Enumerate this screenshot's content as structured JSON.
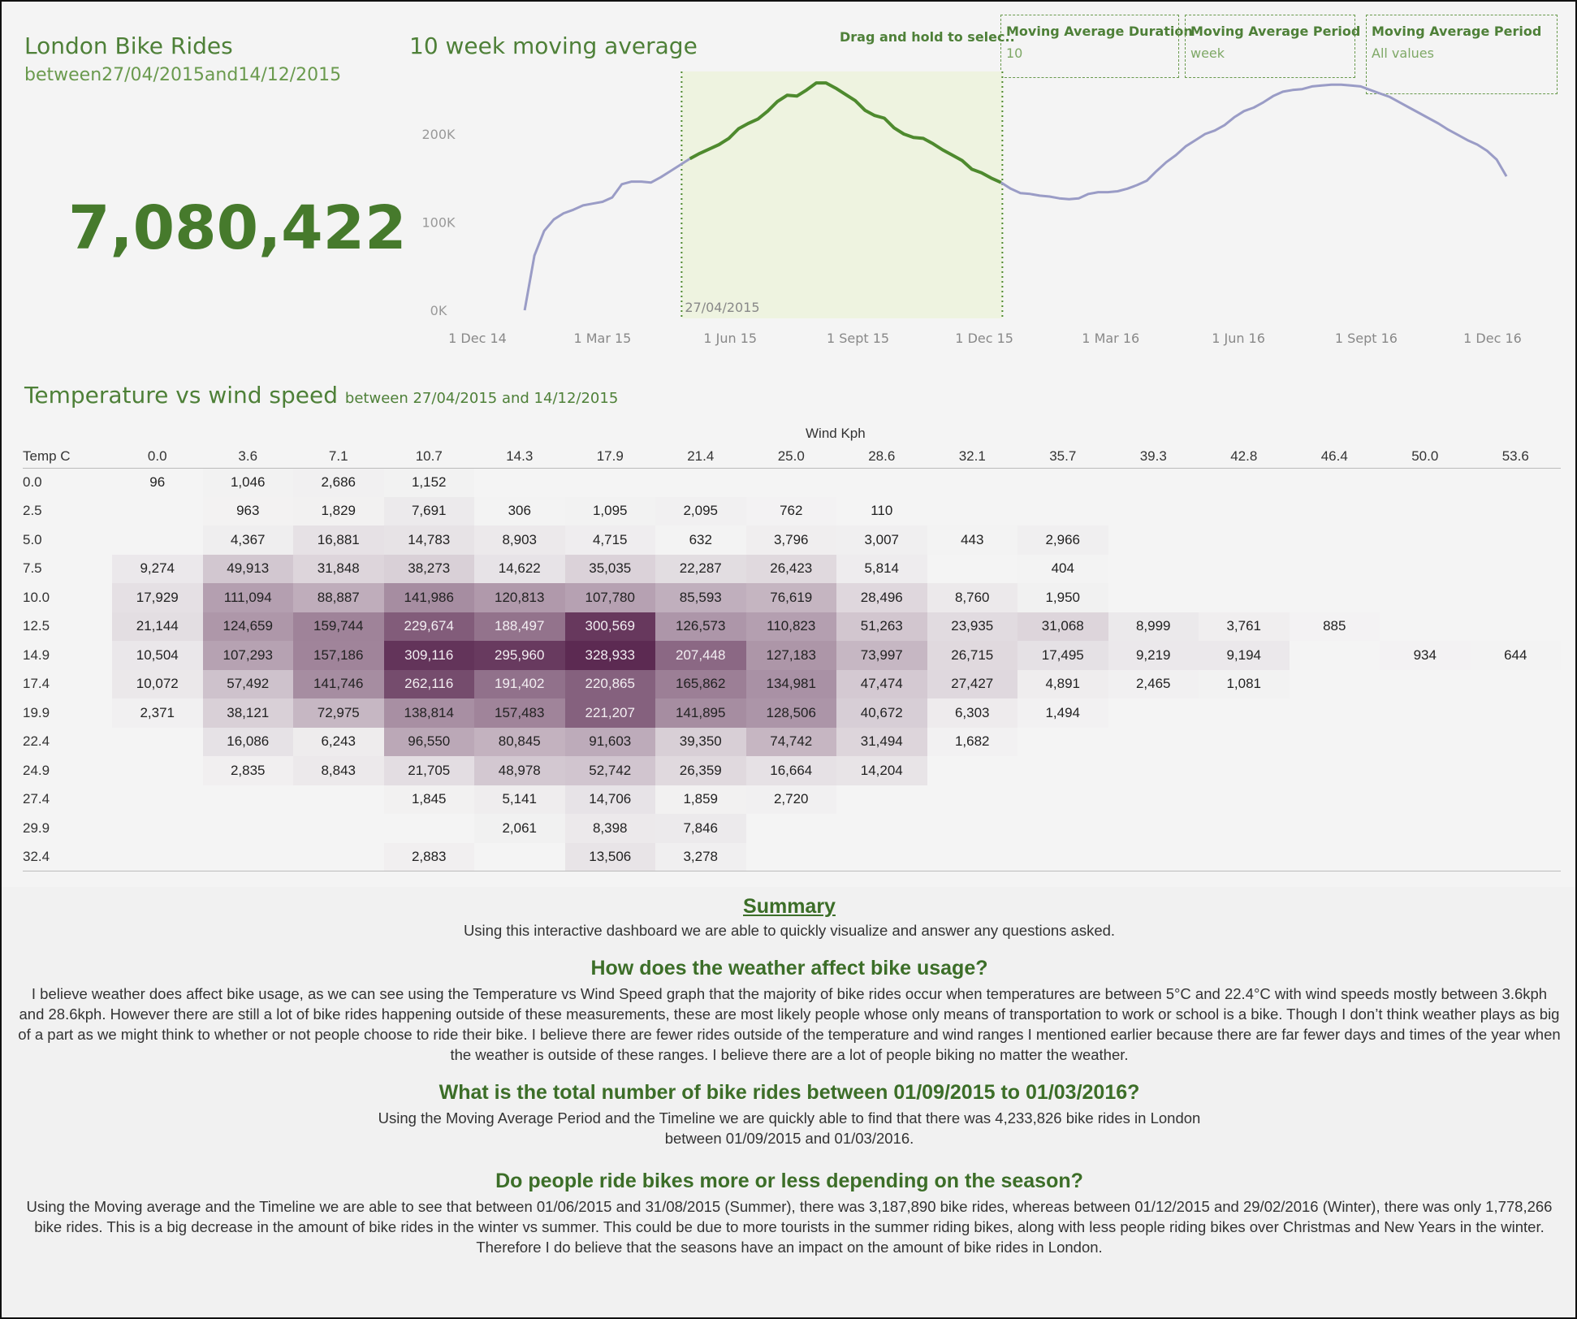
{
  "header": {
    "title": "London Bike Rides",
    "subtitle": "between27/04/2015and14/12/2015",
    "kpi": "7,080,422"
  },
  "moving_average": {
    "title": "10 week moving average",
    "drag_hint": "Drag and hold to selec..",
    "selection_label": "27/04/2015"
  },
  "params": [
    {
      "label": "Moving Average Duration",
      "value": "10"
    },
    {
      "label": "Moving Average Period",
      "value": "week"
    },
    {
      "label": "Moving Average Period",
      "value": "All values"
    }
  ],
  "colors": {
    "accent_green": "#4e8038",
    "line_selected": "#4e8a2e",
    "line_unselected": "#9a9cc6",
    "selection_fill": "#eef3e0",
    "heat_low": "#f4f4f4",
    "heat_high": "#5c2a52"
  },
  "chart_data": {
    "type": "line",
    "title": "10 week moving average",
    "x_ticks": [
      "1 Dec 14",
      "1 Mar 15",
      "1 Jun 15",
      "1 Sept 15",
      "1 Dec 15",
      "1 Mar 16",
      "1 Jun 16",
      "1 Sept 16",
      "1 Dec 16"
    ],
    "y_ticks": [
      "0K",
      "100K",
      "200K"
    ],
    "ylim": [
      0,
      260000
    ],
    "selection": {
      "start": "2015-04-27",
      "end": "2015-12-14"
    },
    "series": [
      {
        "points": [
          [
            "2015-01-04",
            0
          ],
          [
            "2015-01-11",
            62000
          ],
          [
            "2015-01-18",
            90000
          ],
          [
            "2015-01-25",
            103000
          ],
          [
            "2015-02-01",
            110000
          ],
          [
            "2015-02-08",
            114000
          ],
          [
            "2015-02-15",
            119000
          ],
          [
            "2015-02-22",
            121000
          ],
          [
            "2015-03-01",
            123000
          ],
          [
            "2015-03-08",
            128000
          ],
          [
            "2015-03-15",
            143000
          ],
          [
            "2015-03-22",
            146000
          ],
          [
            "2015-03-29",
            146000
          ],
          [
            "2015-04-05",
            145000
          ],
          [
            "2015-04-12",
            151000
          ],
          [
            "2015-04-19",
            158000
          ],
          [
            "2015-04-26",
            165000
          ],
          [
            "2015-05-03",
            172000
          ],
          [
            "2015-05-10",
            178000
          ],
          [
            "2015-05-17",
            183000
          ],
          [
            "2015-05-24",
            188000
          ],
          [
            "2015-05-31",
            195000
          ],
          [
            "2015-06-07",
            206000
          ],
          [
            "2015-06-14",
            212000
          ],
          [
            "2015-06-21",
            217000
          ],
          [
            "2015-06-28",
            226000
          ],
          [
            "2015-07-05",
            237000
          ],
          [
            "2015-07-12",
            244000
          ],
          [
            "2015-07-19",
            243000
          ],
          [
            "2015-07-26",
            250000
          ],
          [
            "2015-08-02",
            258000
          ],
          [
            "2015-08-09",
            258000
          ],
          [
            "2015-08-16",
            252000
          ],
          [
            "2015-08-23",
            245000
          ],
          [
            "2015-08-30",
            238000
          ],
          [
            "2015-09-06",
            227000
          ],
          [
            "2015-09-13",
            221000
          ],
          [
            "2015-09-20",
            218000
          ],
          [
            "2015-09-27",
            207000
          ],
          [
            "2015-10-04",
            200000
          ],
          [
            "2015-10-11",
            196000
          ],
          [
            "2015-10-18",
            195000
          ],
          [
            "2015-10-25",
            189000
          ],
          [
            "2015-11-01",
            182000
          ],
          [
            "2015-11-08",
            176000
          ],
          [
            "2015-11-15",
            170000
          ],
          [
            "2015-11-22",
            160000
          ],
          [
            "2015-11-29",
            156000
          ],
          [
            "2015-12-06",
            150000
          ],
          [
            "2015-12-13",
            145000
          ],
          [
            "2015-12-20",
            138000
          ],
          [
            "2015-12-27",
            133000
          ],
          [
            "2016-01-03",
            132000
          ],
          [
            "2016-01-10",
            130000
          ],
          [
            "2016-01-17",
            129000
          ],
          [
            "2016-01-24",
            127000
          ],
          [
            "2016-01-31",
            126000
          ],
          [
            "2016-02-07",
            127000
          ],
          [
            "2016-02-14",
            132000
          ],
          [
            "2016-02-21",
            134000
          ],
          [
            "2016-02-28",
            134000
          ],
          [
            "2016-03-06",
            135000
          ],
          [
            "2016-03-13",
            138000
          ],
          [
            "2016-03-20",
            142000
          ],
          [
            "2016-03-27",
            147000
          ],
          [
            "2016-04-03",
            158000
          ],
          [
            "2016-04-10",
            168000
          ],
          [
            "2016-04-17",
            176000
          ],
          [
            "2016-04-24",
            186000
          ],
          [
            "2016-05-01",
            193000
          ],
          [
            "2016-05-08",
            200000
          ],
          [
            "2016-05-15",
            204000
          ],
          [
            "2016-05-22",
            210000
          ],
          [
            "2016-05-29",
            219000
          ],
          [
            "2016-06-05",
            226000
          ],
          [
            "2016-06-12",
            230000
          ],
          [
            "2016-06-19",
            236000
          ],
          [
            "2016-06-26",
            243000
          ],
          [
            "2016-07-03",
            248000
          ],
          [
            "2016-07-10",
            250000
          ],
          [
            "2016-07-17",
            251000
          ],
          [
            "2016-07-24",
            254000
          ],
          [
            "2016-07-31",
            255000
          ],
          [
            "2016-08-07",
            256000
          ],
          [
            "2016-08-14",
            256000
          ],
          [
            "2016-08-21",
            255000
          ],
          [
            "2016-08-28",
            254000
          ],
          [
            "2016-09-04",
            250000
          ],
          [
            "2016-09-11",
            246000
          ],
          [
            "2016-09-18",
            242000
          ],
          [
            "2016-09-25",
            236000
          ],
          [
            "2016-10-02",
            230000
          ],
          [
            "2016-10-09",
            224000
          ],
          [
            "2016-10-16",
            218000
          ],
          [
            "2016-10-23",
            212000
          ],
          [
            "2016-10-30",
            205000
          ],
          [
            "2016-11-06",
            199000
          ],
          [
            "2016-11-13",
            193000
          ],
          [
            "2016-11-20",
            188000
          ],
          [
            "2016-11-27",
            181000
          ],
          [
            "2016-12-04",
            171000
          ],
          [
            "2016-12-11",
            152000
          ]
        ]
      }
    ]
  },
  "heatmap": {
    "title": "Temperature vs wind speed",
    "title_suffix": "between 27/04/2015 and 14/12/2015",
    "xlabel": "Wind Kph",
    "row_header": "Temp C",
    "max_value": 328933,
    "columns": [
      "0.0",
      "3.6",
      "7.1",
      "10.7",
      "14.3",
      "17.9",
      "21.4",
      "25.0",
      "28.6",
      "32.1",
      "35.7",
      "39.3",
      "42.8",
      "46.4",
      "50.0",
      "53.6"
    ],
    "rows": [
      {
        "label": "0.0",
        "values": [
          96,
          1046,
          2686,
          1152,
          null,
          null,
          null,
          null,
          null,
          null,
          null,
          null,
          null,
          null,
          null,
          null
        ]
      },
      {
        "label": "2.5",
        "values": [
          null,
          963,
          1829,
          7691,
          306,
          1095,
          2095,
          762,
          110,
          null,
          null,
          null,
          null,
          null,
          null,
          null
        ]
      },
      {
        "label": "5.0",
        "values": [
          null,
          4367,
          16881,
          14783,
          8903,
          4715,
          632,
          3796,
          3007,
          443,
          2966,
          null,
          null,
          null,
          null,
          null
        ]
      },
      {
        "label": "7.5",
        "values": [
          9274,
          49913,
          31848,
          38273,
          14622,
          35035,
          22287,
          26423,
          5814,
          null,
          404,
          null,
          null,
          null,
          null,
          null
        ]
      },
      {
        "label": "10.0",
        "values": [
          17929,
          111094,
          88887,
          141986,
          120813,
          107780,
          85593,
          76619,
          28496,
          8760,
          1950,
          null,
          null,
          null,
          null,
          null
        ]
      },
      {
        "label": "12.5",
        "values": [
          21144,
          124659,
          159744,
          229674,
          188497,
          300569,
          126573,
          110823,
          51263,
          23935,
          31068,
          8999,
          3761,
          885,
          null,
          null
        ]
      },
      {
        "label": "14.9",
        "values": [
          10504,
          107293,
          157186,
          309116,
          295960,
          328933,
          207448,
          127183,
          73997,
          26715,
          17495,
          9219,
          9194,
          null,
          934,
          644
        ]
      },
      {
        "label": "17.4",
        "values": [
          10072,
          57492,
          141746,
          262116,
          191402,
          220865,
          165862,
          134981,
          47474,
          27427,
          4891,
          2465,
          1081,
          null,
          null,
          null
        ]
      },
      {
        "label": "19.9",
        "values": [
          2371,
          38121,
          72975,
          138814,
          157483,
          221207,
          141895,
          128506,
          40672,
          6303,
          1494,
          null,
          null,
          null,
          null,
          null
        ]
      },
      {
        "label": "22.4",
        "values": [
          null,
          16086,
          6243,
          96550,
          80845,
          91603,
          39350,
          74742,
          31494,
          1682,
          null,
          null,
          null,
          null,
          null,
          null
        ]
      },
      {
        "label": "24.9",
        "values": [
          null,
          2835,
          8843,
          21705,
          48978,
          52742,
          26359,
          16664,
          14204,
          null,
          null,
          null,
          null,
          null,
          null,
          null
        ]
      },
      {
        "label": "27.4",
        "values": [
          null,
          null,
          null,
          1845,
          5141,
          14706,
          1859,
          2720,
          null,
          null,
          null,
          null,
          null,
          null,
          null,
          null
        ]
      },
      {
        "label": "29.9",
        "values": [
          null,
          null,
          null,
          null,
          2061,
          8398,
          7846,
          null,
          null,
          null,
          null,
          null,
          null,
          null,
          null,
          null
        ]
      },
      {
        "label": "32.4",
        "values": [
          null,
          null,
          null,
          2883,
          null,
          13506,
          3278,
          null,
          null,
          null,
          null,
          null,
          null,
          null,
          null,
          null
        ]
      }
    ]
  },
  "summary": {
    "heading": "Summary",
    "intro": "Using this interactive dashboard we are able to quickly visualize and answer any questions asked.",
    "sections": [
      {
        "question": "How does the weather affect bike usage?",
        "answer": "I believe weather does affect bike usage, as we can see using the Temperature vs Wind Speed graph that the majority of bike rides occur when temperatures are between 5°C and 22.4°C with wind speeds mostly between 3.6kph and 28.6kph. However there are still a lot of bike rides happening outside of these measurements, these are most likely people whose only means of transportation to work or school is a bike. Though I don’t think weather plays as big of a part as we might think to whether or not people choose to ride their bike. I believe there are fewer rides outside of the temperature and wind ranges I mentioned earlier because there are far fewer days and times of the year when the weather is outside of these ranges. I believe there are a lot of people biking no matter the weather."
      },
      {
        "question": "What is the total number of bike rides between 01/09/2015 to 01/03/2016?",
        "answer": "Using the Moving Average Period and the Timeline we are quickly able to find that there was 4,233,826 bike rides in London between 01/09/2015 and 01/03/2016."
      },
      {
        "question": "Do people ride bikes more or less depending on the season?",
        "answer": "Using the Moving average and the Timeline we are able to see that between 01/06/2015 and 31/08/2015 (Summer), there was 3,187,890 bike rides, whereas between 01/12/2015 and 29/02/2016 (Winter), there was only 1,778,266 bike rides. This is a big decrease in the amount of bike rides in the winter vs summer. This could be due to more tourists in the summer riding bikes, along with less people riding bikes over Christmas and New Years in the winter. Therefore I do believe that the seasons have an impact on the amount of bike rides in London."
      }
    ]
  }
}
